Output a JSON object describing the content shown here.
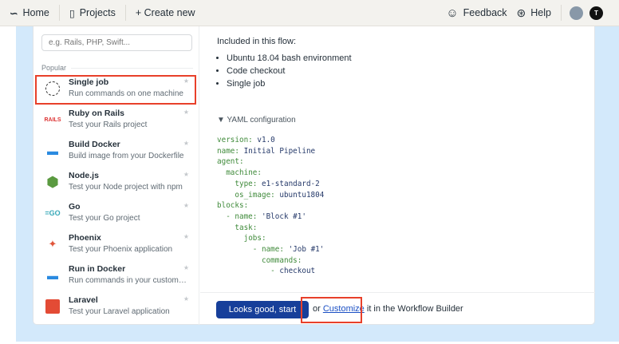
{
  "topbar": {
    "home": "Home",
    "projects": "Projects",
    "create": "+ Create new",
    "feedback": "Feedback",
    "help": "Help",
    "user_initial": "T"
  },
  "sidebar": {
    "search_placeholder": "e.g. Rails, PHP, Swift...",
    "section": "Popular",
    "items": [
      {
        "title": "Single job",
        "desc": "Run commands on one machine",
        "icon": "dashed-circle-icon"
      },
      {
        "title": "Ruby on Rails",
        "desc": "Test your Rails project",
        "icon": "rails-icon"
      },
      {
        "title": "Build Docker",
        "desc": "Build image from your Dockerfile",
        "icon": "docker-icon"
      },
      {
        "title": "Node.js",
        "desc": "Test your Node project with npm",
        "icon": "nodejs-icon"
      },
      {
        "title": "Go",
        "desc": "Test your Go project",
        "icon": "go-icon"
      },
      {
        "title": "Phoenix",
        "desc": "Test your Phoenix application",
        "icon": "phoenix-icon"
      },
      {
        "title": "Run in Docker",
        "desc": "Run commands in your custom pre...",
        "icon": "docker-icon"
      },
      {
        "title": "Laravel",
        "desc": "Test your Laravel application",
        "icon": "laravel-icon"
      }
    ]
  },
  "main": {
    "included_title": "Included in this flow:",
    "included": [
      "Ubuntu 18.04 bash environment",
      "Code checkout",
      "Single job"
    ],
    "yaml_toggle": "▼ YAML configuration",
    "yaml": [
      [
        "",
        "version:",
        " v1.0"
      ],
      [
        "",
        "name:",
        " Initial Pipeline"
      ],
      [
        "",
        "agent:",
        ""
      ],
      [
        "  ",
        "machine:",
        ""
      ],
      [
        "    ",
        "type:",
        " e1-standard-2"
      ],
      [
        "    ",
        "os_image:",
        " ubuntu1804"
      ],
      [
        "",
        "blocks:",
        ""
      ],
      [
        "  - ",
        "name:",
        " 'Block #1'"
      ],
      [
        "    ",
        "task:",
        ""
      ],
      [
        "      ",
        "jobs:",
        ""
      ],
      [
        "        - ",
        "name:",
        " 'Job #1'"
      ],
      [
        "          ",
        "commands:",
        ""
      ],
      [
        "            - ",
        "",
        "checkout"
      ]
    ],
    "start_button": "Looks good, start",
    "or": "or ",
    "customize": "Customize",
    "suffix": " it in the Workflow Builder"
  }
}
